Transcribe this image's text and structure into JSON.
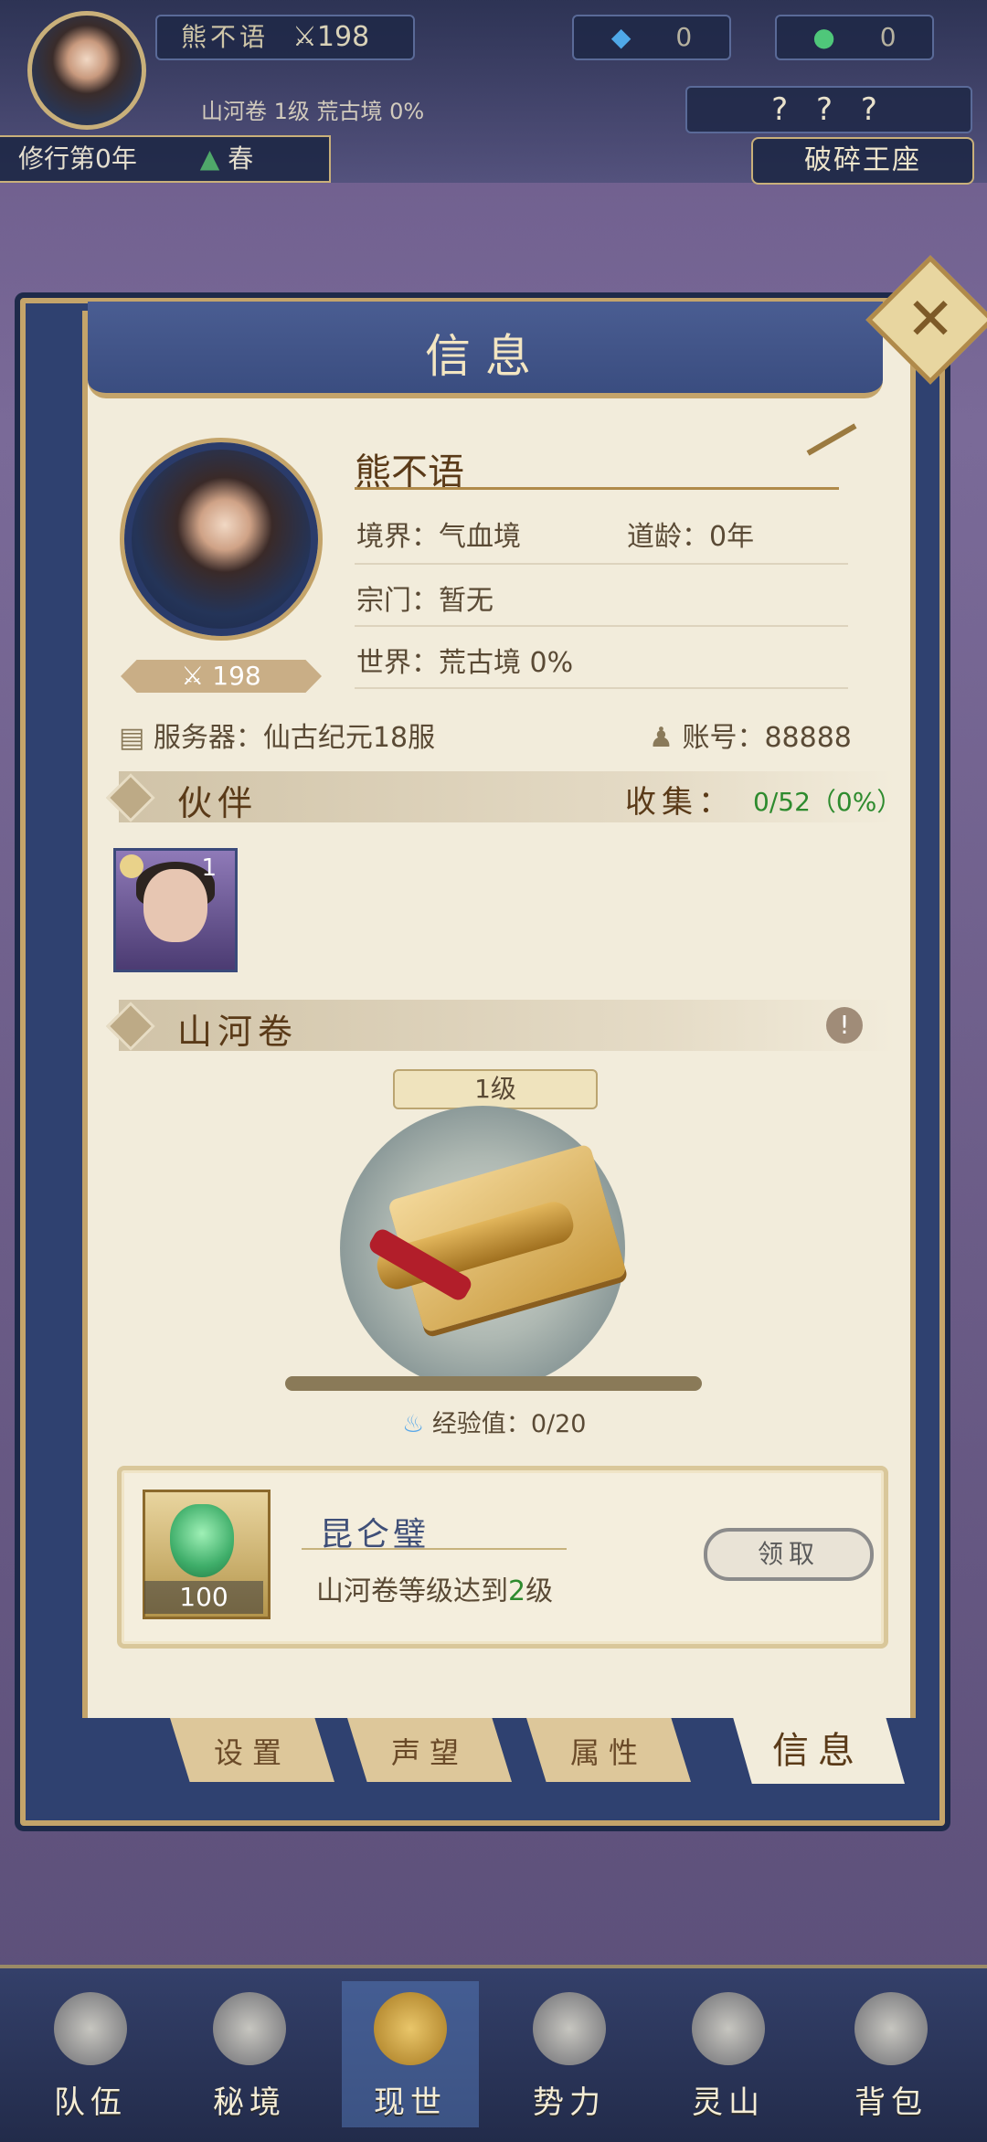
{
  "hud": {
    "player_name": "熊不语",
    "power": "198",
    "currency1": "0",
    "currency2": "0",
    "sub_info": "山河卷 1级  荒古境 0%",
    "cultivation_year": "修行第0年",
    "season": "春",
    "question_marks": "? ? ?",
    "right_tag": "破碎王座"
  },
  "panel": {
    "title": "信息",
    "profile": {
      "name": "熊不语",
      "power": "198",
      "realm_label": "境界：",
      "realm_value": "气血境",
      "age_label": "道龄：",
      "age_value": "0年",
      "sect_label": "宗门：",
      "sect_value": "暂无",
      "world_label": "世界：",
      "world_value": "荒古境  0%",
      "server_label": "服务器：",
      "server_value": "仙古纪元18服",
      "account_label": "账号：",
      "account_value": "88888"
    },
    "partners": {
      "section_title": "伙伴",
      "collect_label": "收集：",
      "collect_value": "0/52（0%）",
      "items": [
        {
          "count": "1"
        }
      ]
    },
    "scroll": {
      "section_title": "山河卷",
      "level": "1级",
      "exp_label": "经验值：",
      "exp_value": "0/20",
      "exp_progress": 0
    },
    "reward": {
      "item_count": "100",
      "title": "昆仑璧",
      "desc_prefix": "山河卷等级达到",
      "desc_level": "2",
      "desc_suffix": "级",
      "claim_label": "领取"
    },
    "tabs": [
      "设置",
      "声望",
      "属性",
      "信息"
    ],
    "active_tab": "信息"
  },
  "bottom_nav": [
    {
      "label": "队伍",
      "icon": "helmet-icon"
    },
    {
      "label": "秘境",
      "icon": "swirl-icon"
    },
    {
      "label": "现世",
      "icon": "scroll-map-icon"
    },
    {
      "label": "势力",
      "icon": "temple-icon"
    },
    {
      "label": "灵山",
      "icon": "mountain-icon"
    },
    {
      "label": "背包",
      "icon": "bag-icon"
    }
  ],
  "colors": {
    "paper": "#f2ecdb",
    "frame_blue": "#2f4170",
    "gold": "#c4a46a",
    "green_text": "#2e8b2e"
  }
}
